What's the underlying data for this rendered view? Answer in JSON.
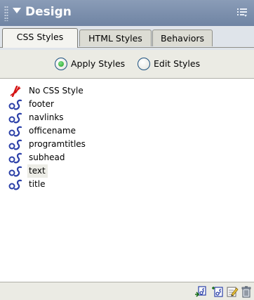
{
  "panel": {
    "title": "Design",
    "grip_icon": "gripper-icon",
    "collapse_icon": "collapse-arrow-icon",
    "options_icon": "panel-options-icon"
  },
  "tabs": [
    {
      "label": "CSS Styles",
      "active": true
    },
    {
      "label": "HTML Styles",
      "active": false
    },
    {
      "label": "Behaviors",
      "active": false
    }
  ],
  "mode": {
    "apply_label": "Apply Styles",
    "edit_label": "Edit Styles",
    "selected": "Apply Styles"
  },
  "styles": [
    {
      "label": "No CSS Style",
      "icon": "no-style-icon"
    },
    {
      "label": "footer",
      "icon": "css-style-icon"
    },
    {
      "label": "navlinks",
      "icon": "css-style-icon"
    },
    {
      "label": "officename",
      "icon": "css-style-icon"
    },
    {
      "label": "programtitles",
      "icon": "css-style-icon"
    },
    {
      "label": "subhead",
      "icon": "css-style-icon"
    },
    {
      "label": "text",
      "icon": "css-style-icon",
      "selected": true
    },
    {
      "label": "title",
      "icon": "css-style-icon"
    }
  ],
  "toolbar": {
    "buttons": [
      "attach-style-sheet-icon",
      "new-style-icon",
      "edit-style-icon",
      "delete-style-icon"
    ]
  },
  "colors": {
    "titlebar": "#7b8eab",
    "css_icon_blue": "#2a3fa8",
    "no_style_red": "#d41414",
    "radio_selected": "#21a121"
  }
}
